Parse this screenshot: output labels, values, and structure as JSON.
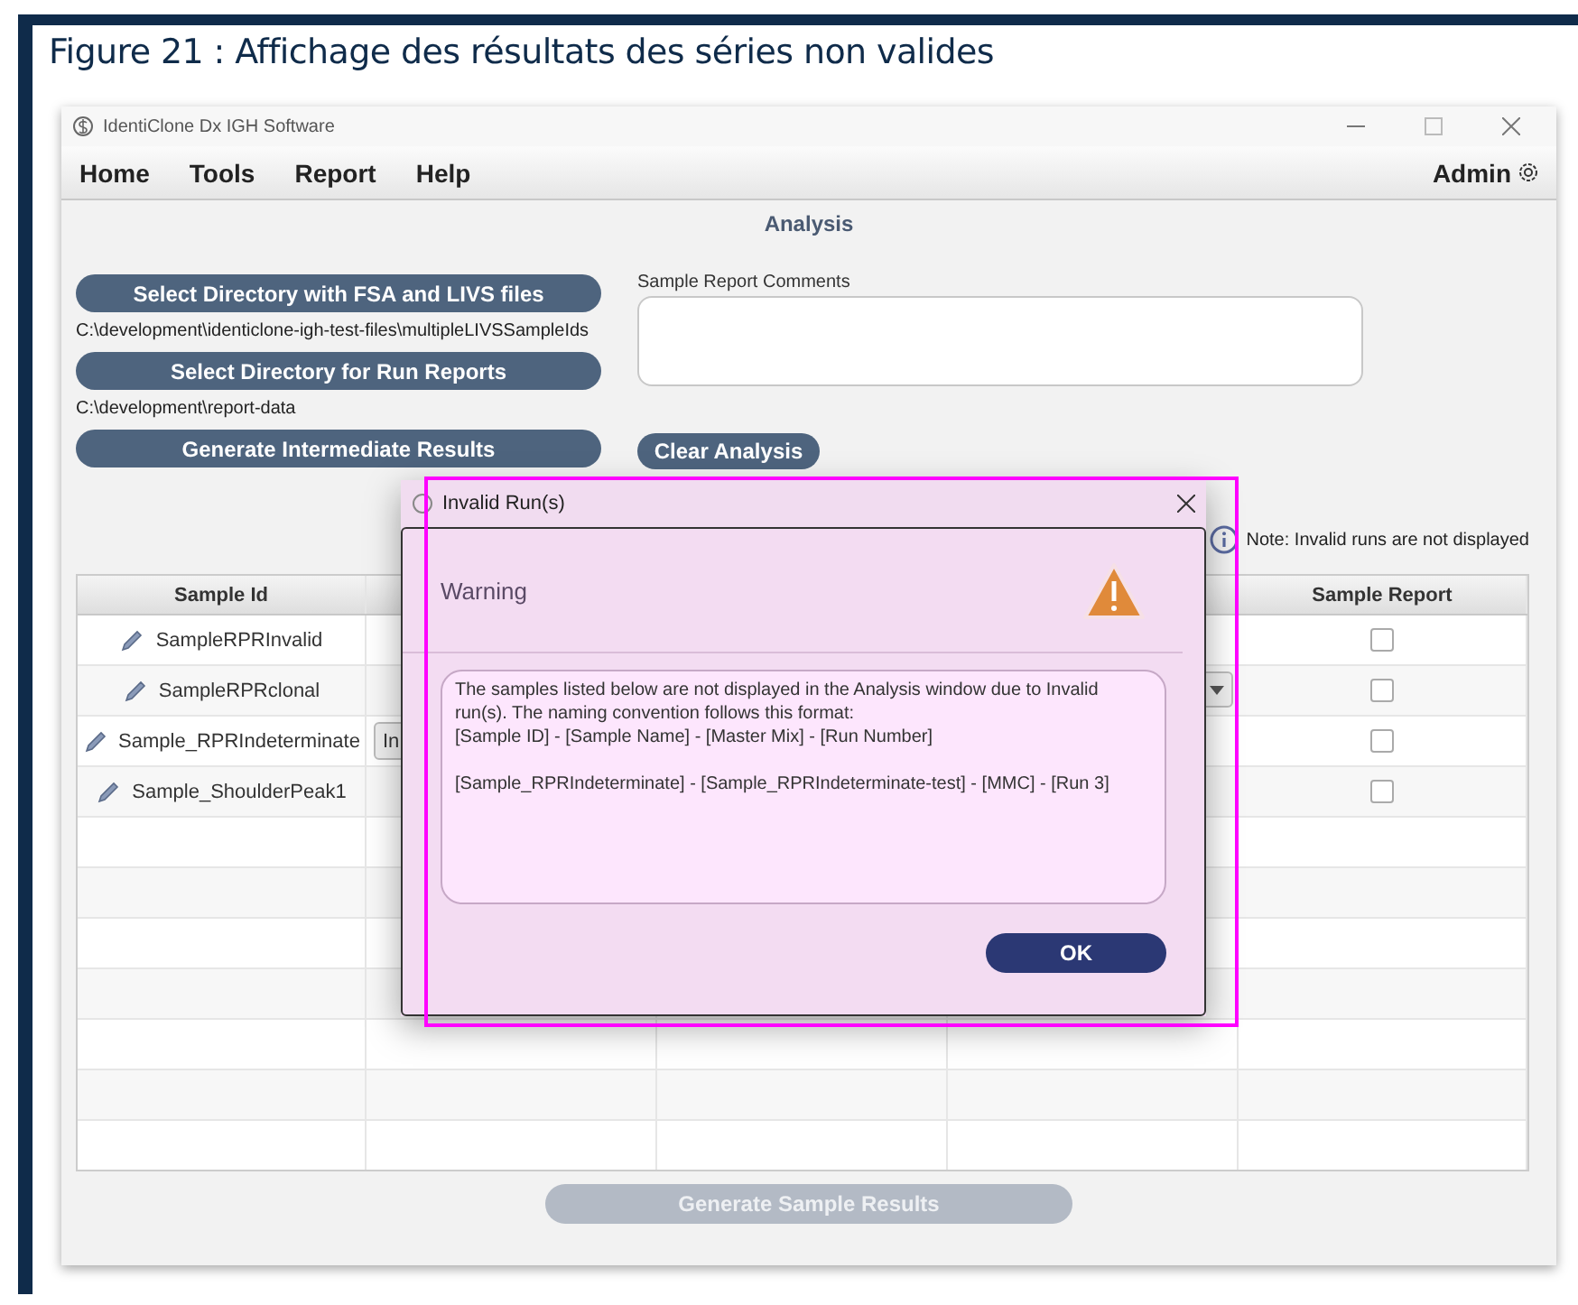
{
  "figure": {
    "caption": "Figure 21 :  Affichage des résultats des séries non valides"
  },
  "window": {
    "title": "IdentiClone Dx IGH Software"
  },
  "menu": {
    "items": [
      "Home",
      "Tools",
      "Report",
      "Help"
    ],
    "user": "Admin"
  },
  "page_title": "Analysis",
  "left_panel": [
    {
      "kind": "button",
      "text": "Select Directory with FSA and LIVS files"
    },
    {
      "kind": "path",
      "text": "C:\\development\\identiclone-igh-test-files\\multipleLIVSSampleIds"
    },
    {
      "kind": "button",
      "text": "Select Directory for Run Reports"
    },
    {
      "kind": "path",
      "text": "C:\\development\\report-data"
    },
    {
      "kind": "button",
      "text": "Generate Intermediate Results"
    }
  ],
  "comments": {
    "label": "Sample Report Comments"
  },
  "clear_button": "Clear Analysis",
  "note": "Note: Invalid runs are not displayed",
  "table": {
    "columns": [
      {
        "label": "Sample Id"
      },
      {
        "label": "Sample Report"
      }
    ],
    "rows": [
      {
        "sample_id": "SampleRPRInvalid",
        "report_checked": false
      },
      {
        "sample_id": "SampleRPRclonal",
        "report_checked": false,
        "column_4": {
          "kind": "dropdown"
        }
      },
      {
        "sample_id": "Sample_RPRIndeterminate",
        "report_checked": false,
        "column_2": {
          "kind": "button",
          "text": "In"
        }
      },
      {
        "sample_id": "Sample_ShoulderPeak1",
        "report_checked": false
      }
    ]
  },
  "generate_button": {
    "label": "Generate Sample Results",
    "disabled": true
  },
  "dialog": {
    "title": "Invalid Run(s)",
    "heading": "Warning",
    "highlighted": true,
    "intro": "The samples listed below are not displayed in the Analysis window due to Invalid run(s). The naming convention follows this format:",
    "format": "[Sample ID] - [Sample Name] - [Master Mix] - [Run Number]",
    "entries": [
      "[Sample_RPRIndeterminate] - [Sample_RPRIndeterminate-test] - [MMC] - [Run 3]"
    ],
    "ok": "OK"
  }
}
